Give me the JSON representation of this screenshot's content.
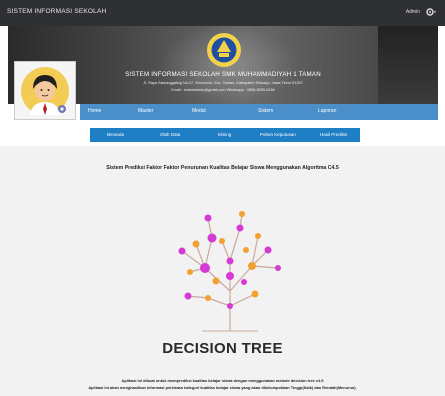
{
  "topbar": {
    "brand": "SISTEM INFORMASI SEKOLAH",
    "user_label": "Admin",
    "user_icon": "gear-icon"
  },
  "banner": {
    "title": "SISTEM INFORMASI SEKOLAH SMK MUHAMMADIYAH 1 TAMAN",
    "address": "Jl. Raya Sawunggaling No.17, Wonocolo, Kec. Taman, Kabupaten Sidoarjo, Jawa Timur 61257",
    "contact": "Email : smkmhdsda@gmail.com   Whatsapp : 0856-5555-6166"
  },
  "main_nav": {
    "items": [
      "Home",
      "Master",
      "Modul",
      "Sistem",
      "Laporan"
    ]
  },
  "sub_nav": {
    "items": [
      "Beranda",
      "Olah Data",
      "Mining",
      "Pohon Keputusan",
      "Hasil Prediksi"
    ]
  },
  "content": {
    "heading": "Sistem Prediksi Faktor Faktor Penurunan Kualitas Belajar Siswa Menggunakan Algoritma C4.5",
    "illustration_title": "DECISION TREE",
    "description_1": "Aplikasi ini dibuat untuk memprediksi kualitas belajar siswa dengan menggunakan metode decision tree c4.5",
    "description_2": "Aplikasi ini akan menghasilkan informasi perkiraan kategori kualitas belajar siswa yang akan dikelompokkan Tinggi(Naik) dan Rendah(Menurun)."
  },
  "colors": {
    "topbar": "#2f3033",
    "main_nav": "#4a8fc9",
    "sub_nav": "#1f7fc4",
    "content_bg": "#f2f2f2",
    "tree_magenta": "#d63ad6",
    "tree_orange": "#f2a033"
  }
}
